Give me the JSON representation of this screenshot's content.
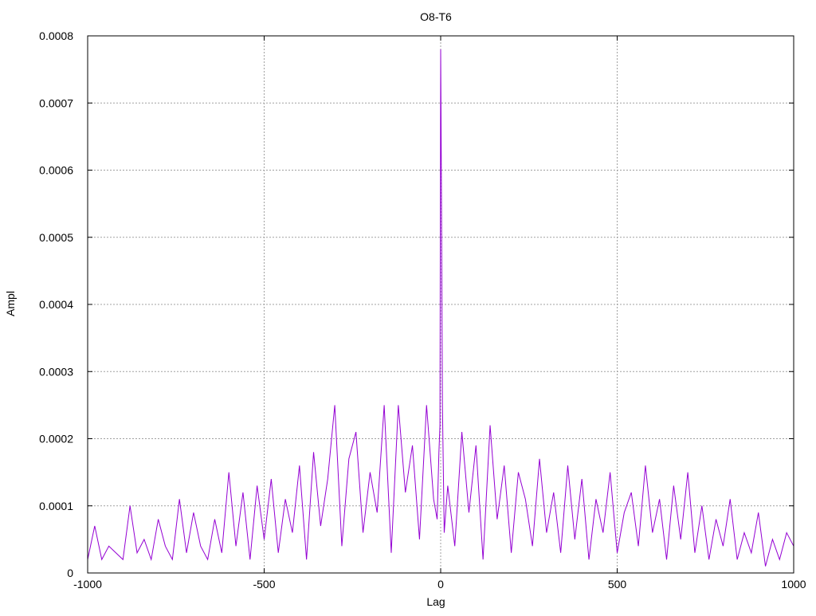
{
  "chart_data": {
    "type": "line",
    "title": "O8-T6",
    "xlabel": "Lag",
    "ylabel": "Ampl",
    "xlim": [
      -1000,
      1000
    ],
    "ylim": [
      0,
      0.0008
    ],
    "x_ticks": [
      -1000,
      -500,
      0,
      500,
      1000
    ],
    "x_tick_labels": [
      "-1000",
      "-500",
      "0",
      "500",
      "1000"
    ],
    "y_ticks": [
      0,
      0.0001,
      0.0002,
      0.0003,
      0.0004,
      0.0005,
      0.0006,
      0.0007,
      0.0008
    ],
    "y_tick_labels": [
      "0",
      "0.0001",
      "0.0002",
      "0.0003",
      "0.0004",
      "0.0005",
      "0.0006",
      "0.0007",
      "0.0008"
    ],
    "grid": true,
    "legend": "none",
    "series": [
      {
        "color": "#9400d3",
        "x": [
          -1000,
          -980,
          -960,
          -940,
          -920,
          -900,
          -880,
          -860,
          -840,
          -820,
          -800,
          -780,
          -760,
          -740,
          -720,
          -700,
          -680,
          -660,
          -640,
          -620,
          -600,
          -580,
          -560,
          -540,
          -520,
          -500,
          -480,
          -460,
          -440,
          -420,
          -400,
          -380,
          -360,
          -340,
          -320,
          -300,
          -280,
          -260,
          -240,
          -220,
          -200,
          -180,
          -160,
          -140,
          -120,
          -100,
          -80,
          -60,
          -40,
          -20,
          -10,
          -5,
          -2,
          0,
          2,
          5,
          10,
          20,
          40,
          60,
          80,
          100,
          120,
          140,
          160,
          180,
          200,
          220,
          240,
          260,
          280,
          300,
          320,
          340,
          360,
          380,
          400,
          420,
          440,
          460,
          480,
          500,
          520,
          540,
          560,
          580,
          600,
          620,
          640,
          660,
          680,
          700,
          720,
          740,
          760,
          780,
          800,
          820,
          840,
          860,
          880,
          900,
          920,
          940,
          960,
          980,
          1000
        ],
        "y": [
          2e-05,
          7e-05,
          2e-05,
          4e-05,
          3e-05,
          2e-05,
          0.0001,
          3e-05,
          5e-05,
          2e-05,
          8e-05,
          4e-05,
          2e-05,
          0.00011,
          3e-05,
          9e-05,
          4e-05,
          2e-05,
          8e-05,
          3e-05,
          0.00015,
          4e-05,
          0.00012,
          2e-05,
          0.00013,
          5e-05,
          0.00014,
          3e-05,
          0.00011,
          6e-05,
          0.00016,
          2e-05,
          0.00018,
          7e-05,
          0.00014,
          0.00025,
          4e-05,
          0.00017,
          0.00021,
          6e-05,
          0.00015,
          9e-05,
          0.00025,
          3e-05,
          0.00025,
          0.00012,
          0.00019,
          5e-05,
          0.00025,
          0.00011,
          8e-05,
          0.00018,
          0.00022,
          0.00078,
          0.00059,
          0.00025,
          6e-05,
          0.00013,
          4e-05,
          0.00021,
          9e-05,
          0.00019,
          2e-05,
          0.00022,
          8e-05,
          0.00016,
          3e-05,
          0.00015,
          0.00011,
          4e-05,
          0.00017,
          6e-05,
          0.00012,
          3e-05,
          0.00016,
          5e-05,
          0.00014,
          2e-05,
          0.00011,
          6e-05,
          0.00015,
          3e-05,
          9e-05,
          0.00012,
          4e-05,
          0.00016,
          6e-05,
          0.00011,
          2e-05,
          0.00013,
          5e-05,
          0.00015,
          3e-05,
          0.0001,
          2e-05,
          8e-05,
          4e-05,
          0.00011,
          2e-05,
          6e-05,
          3e-05,
          9e-05,
          1e-05,
          5e-05,
          2e-05,
          6e-05,
          4e-05
        ]
      }
    ]
  }
}
